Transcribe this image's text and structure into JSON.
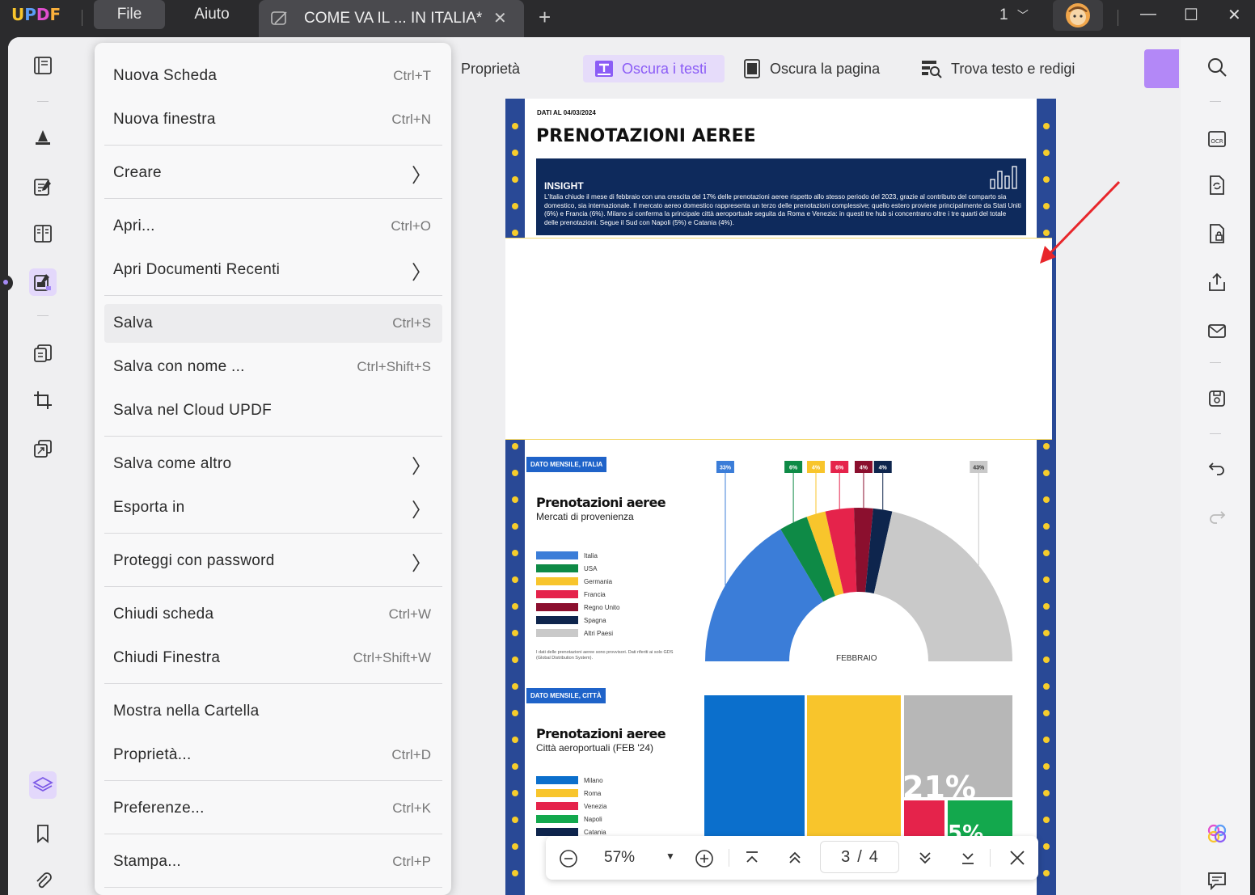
{
  "titlebar": {
    "logo": "UPDF",
    "menu": {
      "file": "File",
      "aiuto": "Aiuto"
    },
    "doc_tab": {
      "title": "COME VA IL ... IN ITALIA*",
      "close": "✕"
    },
    "add_tab": "+",
    "window_count": "1",
    "minimize": "—",
    "maximize": "☐",
    "close": "✕"
  },
  "toolbar": {
    "properties": "Proprietà",
    "redact_text": "Oscura i testi",
    "redact_page": "Oscura la pagina",
    "find_redact": "Trova testo e redigi"
  },
  "file_menu": {
    "items": [
      {
        "label": "Nuova Scheda",
        "shortcut": "Ctrl+T"
      },
      {
        "label": "Nuova finestra",
        "shortcut": "Ctrl+N"
      },
      {
        "label": "Creare",
        "shortcut": ""
      },
      {
        "label": "Apri...",
        "shortcut": "Ctrl+O"
      },
      {
        "label": "Apri Documenti Recenti",
        "shortcut": ""
      },
      {
        "label": "Salva",
        "shortcut": "Ctrl+S"
      },
      {
        "label": "Salva con nome ...",
        "shortcut": "Ctrl+Shift+S"
      },
      {
        "label": "Salva nel Cloud UPDF",
        "shortcut": ""
      },
      {
        "label": "Salva come altro",
        "shortcut": ""
      },
      {
        "label": "Esporta in",
        "shortcut": ""
      },
      {
        "label": "Proteggi con password",
        "shortcut": ""
      },
      {
        "label": "Chiudi scheda",
        "shortcut": "Ctrl+W"
      },
      {
        "label": "Chiudi Finestra",
        "shortcut": "Ctrl+Shift+W"
      },
      {
        "label": "Mostra nella Cartella",
        "shortcut": ""
      },
      {
        "label": "Proprietà...",
        "shortcut": "Ctrl+D"
      },
      {
        "label": "Preferenze...",
        "shortcut": "Ctrl+K"
      },
      {
        "label": "Stampa...",
        "shortcut": "Ctrl+P"
      }
    ],
    "highlighted": "Salva"
  },
  "document": {
    "date": "DATI AL 04/03/2024",
    "title": "PRENOTAZIONI AEREE",
    "insight_title": "INSIGHT",
    "insight_text": "L'Italia chiude il mese di febbraio con una crescita del 17% delle prenotazioni aeree rispetto allo stesso periodo del 2023, grazie al contributo del comparto sia domestico, sia internazionale. Il mercato aereo domestico rappresenta un terzo delle prenotazioni complessive; quello estero proviene principalmente da Stati Uniti (6%) e Francia (6%). Milano si conferma la principale città aeroportuale seguita da Roma e Venezia: in questi tre hub si concentrano oltre i tre quarti del totale delle prenotazioni. Segue il Sud con Napoli (5%) e Catania (4%).",
    "section1_badge": "DATO MENSILE, ITALIA",
    "section1_title": "Prenotazioni aeree",
    "section1_subtitle": "Mercati di provenienza",
    "section1_note": "I dati delle prenotazioni aeree sono provvisori. Dati riferiti ai solo GDS (Global Distribution System).",
    "section1_center_label": "FEBBRAIO",
    "section2_badge": "DATO MENSILE, CITTÀ",
    "section2_title": "Prenotazioni aeree",
    "section2_subtitle": "Città aeroportuali (FEB '24)",
    "treemap_label_1": "21%",
    "treemap_label_2": "5%"
  },
  "chart_data": [
    {
      "type": "pie",
      "title": "Prenotazioni aeree",
      "subtitle": "Mercati di provenienza",
      "categories": [
        "Italia",
        "USA",
        "Germania",
        "Francia",
        "Regno Unito",
        "Spagna",
        "Altri Paesi"
      ],
      "values": [
        33,
        6,
        4,
        6,
        4,
        4,
        43
      ],
      "labels": [
        "33%",
        "6%",
        "4%",
        "6%",
        "4%",
        "4%",
        "43%"
      ],
      "colors": [
        "#3b7dd8",
        "#0e8a46",
        "#f8c52c",
        "#e5234b",
        "#8b0f2e",
        "#0e254d",
        "#c9c9c9"
      ]
    },
    {
      "type": "bar",
      "title": "Prenotazioni aeree",
      "subtitle": "Città aeroportuali (FEB '24)",
      "categories": [
        "Milano",
        "Roma",
        "Venezia",
        "Napoli",
        "Catania"
      ],
      "colors": [
        "#0b6fcc",
        "#f8c52c",
        "#e5234b",
        "#13a84d",
        "#0e254d"
      ]
    }
  ],
  "navbar": {
    "zoom": "57%",
    "page_current": "3",
    "page_sep": "/",
    "page_total": "4"
  },
  "colors": {
    "accent": "#8b5cf6",
    "stripe_blue": "#294996",
    "dot_yellow": "#f6cd2c",
    "insight_bg": "#0e2a5c"
  }
}
